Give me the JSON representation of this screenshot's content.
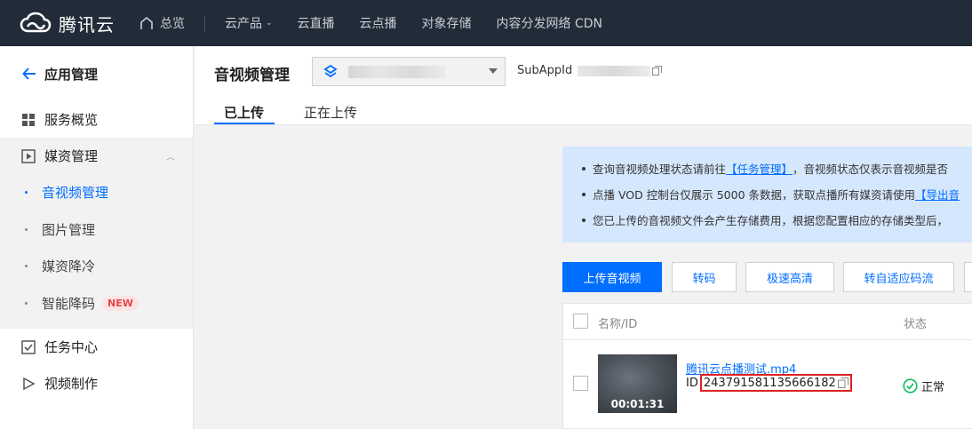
{
  "topbar": {
    "brand": "腾讯云",
    "home": "总览",
    "nav": [
      {
        "label": "云产品",
        "caret": "⌄"
      },
      {
        "label": "云直播"
      },
      {
        "label": "云点播"
      },
      {
        "label": "对象存储"
      },
      {
        "label": "内容分发网络 CDN"
      }
    ]
  },
  "sidebar": {
    "back_label": "应用管理",
    "items": {
      "overview": "服务概览",
      "media": "媒资管理",
      "tasks": "任务中心",
      "video_make": "视频制作"
    },
    "media_sub": [
      {
        "label": "音视频管理",
        "active": true
      },
      {
        "label": "图片管理"
      },
      {
        "label": "媒资降冷"
      },
      {
        "label": "智能降码",
        "badge": "NEW"
      }
    ]
  },
  "header": {
    "title": "音视频管理",
    "subapp_label": "SubAppId",
    "tabs": [
      "已上传",
      "正在上传"
    ]
  },
  "notice": {
    "line1_prefix": "查询音视频处理状态请前往",
    "line1_link": "【任务管理】",
    "line1_suffix": "，音视频状态仅表示音视频是否",
    "line2_prefix": "点播 VOD 控制台仅展示 5000 条数据，获取点播所有媒资请使用",
    "line2_link": "【导出音",
    "line3": "您已上传的音视频文件会产生存储费用，根据您配置相应的存储类型后，"
  },
  "buttons": {
    "upload": "上传音视频",
    "transcode": "转码",
    "fast_hd": "极速高清",
    "adaptive": "转自适应码流"
  },
  "table": {
    "headers": {
      "name": "名称/ID",
      "status": "状态"
    },
    "rows": [
      {
        "name": "腾讯云点播测试.mp4",
        "id_label": "ID",
        "id": "243791581135666182",
        "duration": "00:01:31",
        "status": "正常"
      }
    ]
  },
  "colors": {
    "accent": "#006eff",
    "topbar": "#222c38",
    "highlight_box": "#e02020",
    "ok": "#0abf5b"
  }
}
